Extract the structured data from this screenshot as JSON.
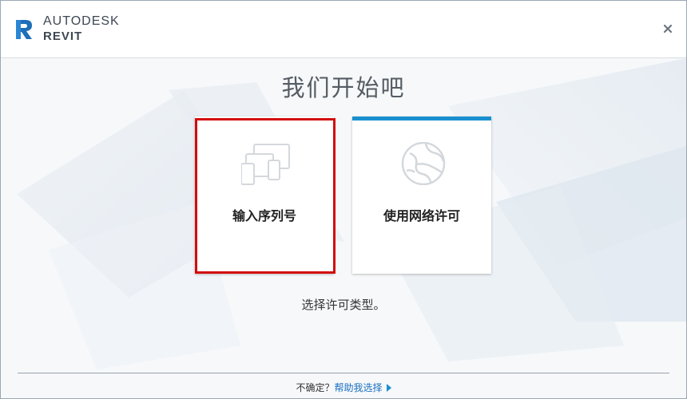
{
  "header": {
    "brand_top": "AUTODESK",
    "brand_bottom": "REVIT",
    "close_glyph": "×"
  },
  "main": {
    "heading": "我们开始吧",
    "options": [
      {
        "label": "输入序列号",
        "icon": "devices-icon"
      },
      {
        "label": "使用网络许可",
        "icon": "globe-icon"
      }
    ],
    "hint": "选择许可类型。"
  },
  "footer": {
    "question": "不确定？",
    "help_link": "帮助我选择"
  },
  "colors": {
    "accent": "#1a8fd0",
    "highlight": "#d30d0d",
    "brand_blue": "#1e6fb8"
  }
}
